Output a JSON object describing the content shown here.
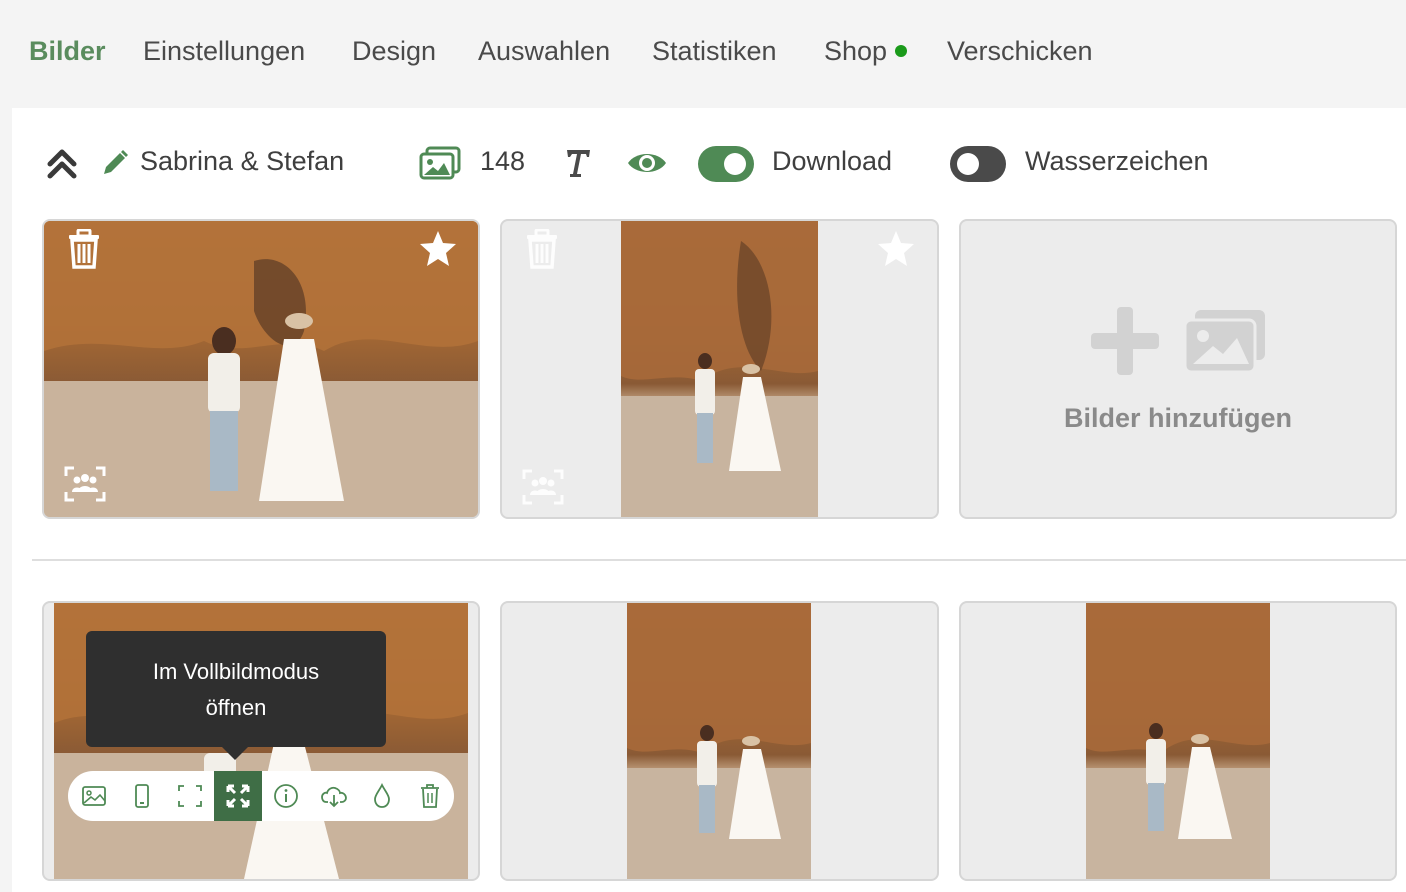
{
  "nav": {
    "tabs": [
      "Bilder",
      "Einstellungen",
      "Design",
      "Auswahlen",
      "Statistiken",
      "Shop",
      "Verschicken"
    ],
    "active": "Bilder",
    "shop_status_color": "#1a9a1a"
  },
  "toolbar": {
    "collapse_icon": "chevrons-up-icon",
    "edit_icon": "pencil-icon",
    "gallery_name": "Sabrina & Stefan",
    "images_icon": "images-icon",
    "image_count": "148",
    "text_icon": "text-icon",
    "visibility_icon": "eye-icon",
    "download_toggle": {
      "label": "Download",
      "on": true
    },
    "watermark_toggle": {
      "label": "Wasserzeichen",
      "on": false
    }
  },
  "grid": {
    "add_card": {
      "label": "Bilder hinzufügen",
      "icons": [
        "plus-icon",
        "images-icon"
      ]
    },
    "cards": [
      {
        "type": "landscape",
        "starred": true
      },
      {
        "type": "portrait",
        "starred": true
      },
      {
        "type": "landscape",
        "hovered": true
      },
      {
        "type": "portrait"
      },
      {
        "type": "portrait"
      }
    ]
  },
  "tooltip": {
    "line1": "Im Vollbildmodus",
    "line2": "öffnen"
  },
  "action_bar": {
    "buttons": [
      "image-icon",
      "phone-icon",
      "crop-icon",
      "fullscreen-icon",
      "info-icon",
      "cloud-download-icon",
      "drop-icon",
      "trash-icon"
    ],
    "active": "fullscreen-icon"
  },
  "colors": {
    "accent": "#5a8c5e",
    "toggle_on": "#4f8a55",
    "toggle_off": "#4a4a4a",
    "tooltip_bg": "#2f2f2f"
  }
}
